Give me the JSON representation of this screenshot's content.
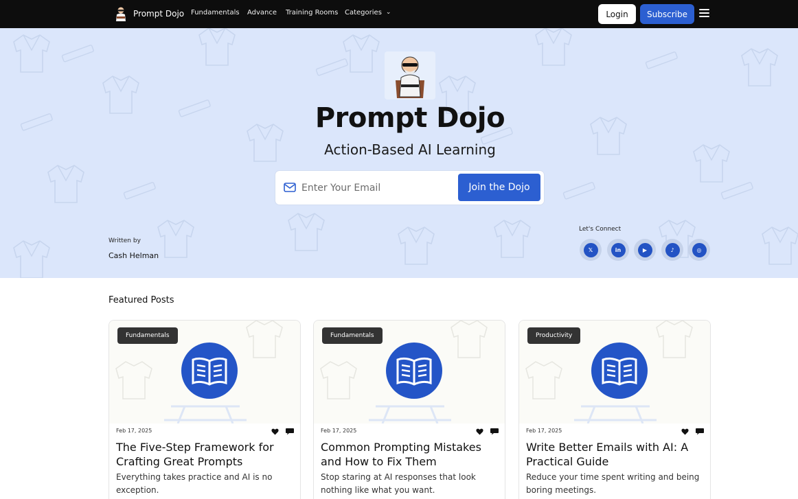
{
  "nav": {
    "brand": "Prompt Dojo",
    "links": [
      "Fundamentals",
      "Advance",
      "Training Rooms",
      "Categories"
    ],
    "login": "Login",
    "subscribe": "Subscribe"
  },
  "hero": {
    "title": "Prompt Dojo",
    "subtitle": "Action-Based AI Learning",
    "email_placeholder": "Enter Your Email",
    "join_button": "Join the Dojo",
    "written_by_label": "Written by",
    "author": "Cash Helman",
    "connect_label": "Let's Connect",
    "socials": [
      {
        "icon": "x-icon",
        "glyph": "𝕏"
      },
      {
        "icon": "linkedin-icon",
        "glyph": "in"
      },
      {
        "icon": "youtube-icon",
        "glyph": "▶"
      },
      {
        "icon": "tiktok-icon",
        "glyph": "♪"
      },
      {
        "icon": "instagram-icon",
        "glyph": "◎"
      }
    ]
  },
  "featured": {
    "title": "Featured Posts",
    "posts": [
      {
        "tag": "Fundamentals",
        "date": "Feb 17, 2025",
        "title": "The Five-Step Framework for Crafting Great Prompts",
        "excerpt": "Everything takes practice and AI is no exception."
      },
      {
        "tag": "Fundamentals",
        "date": "Feb 17, 2025",
        "title": "Common Prompting Mistakes and How to Fix Them",
        "excerpt": "Stop staring at AI responses that look nothing like what you want."
      },
      {
        "tag": "Productivity",
        "date": "Feb 17, 2025",
        "title": "Write Better Emails with AI: A Practical Guide",
        "excerpt": "Reduce your time spent writing and being boring meetings."
      }
    ]
  },
  "colors": {
    "nav_bg": "#0d0d0d",
    "accent": "#2c5fd1",
    "hero_bg": "#dbe6fb",
    "tag_bg": "#333333"
  }
}
